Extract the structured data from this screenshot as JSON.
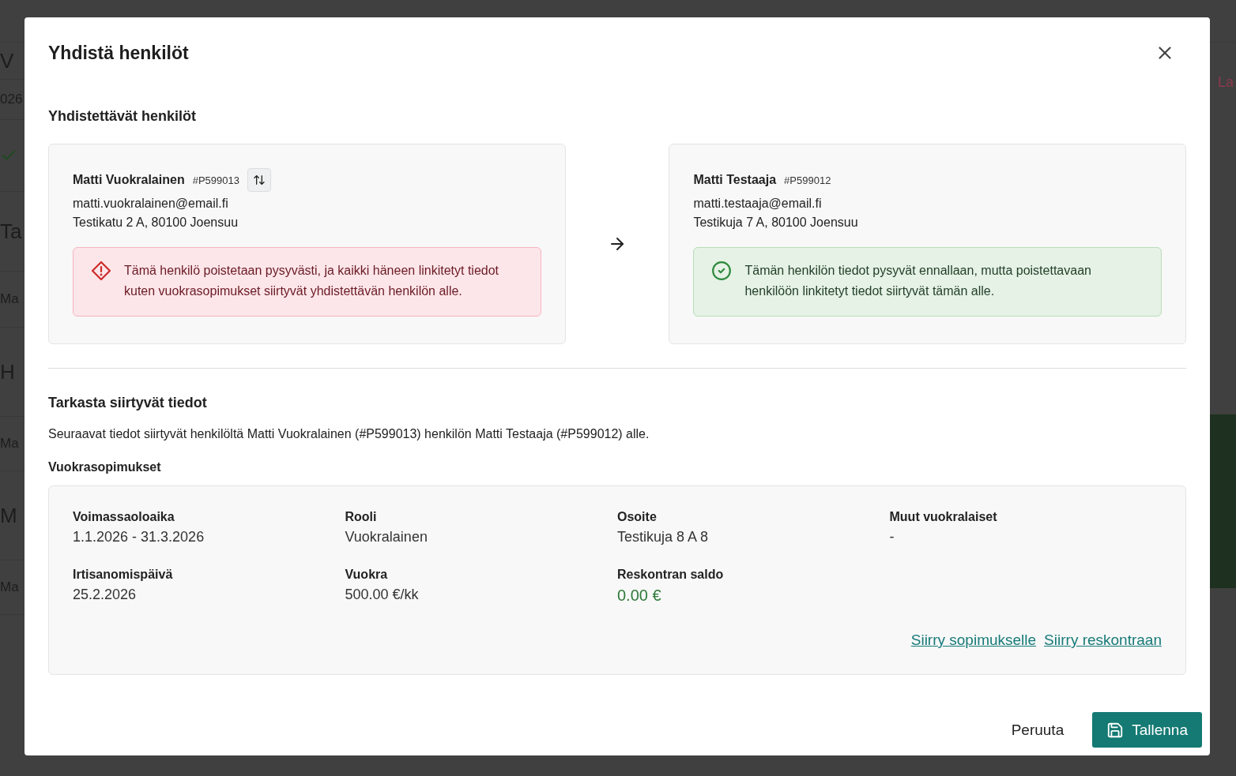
{
  "background": {
    "left_texts": [
      {
        "kind": "title",
        "text": "V"
      },
      {
        "kind": "small",
        "text": "026"
      },
      {
        "kind": "check"
      },
      {
        "kind": "heading",
        "text": "Ta"
      },
      {
        "kind": "small",
        "text": "Ma"
      },
      {
        "kind": "heading",
        "text": "H"
      },
      {
        "kind": "small",
        "text": "Ma"
      },
      {
        "kind": "heading",
        "text": "M"
      },
      {
        "kind": "small",
        "text": "Ma"
      }
    ],
    "right_text": "La"
  },
  "dialog": {
    "title": "Yhdistä henkilöt",
    "section_title": "Yhdistettävät henkilöt",
    "persons": [
      {
        "kind": "removed",
        "name": "Matti Vuokralainen",
        "id": "#P599013",
        "swap_button": true,
        "email": "matti.vuokralainen@email.fi",
        "address": "Testikatu 2 A, 80100 Joensuu",
        "notice": "Tämä henkilö poistetaan pysyvästi, ja kaikki häneen linkitetyt tiedot kuten vuokrasopimukset siirtyvät yhdistettävän henkilön alle."
      },
      {
        "kind": "kept",
        "name": "Matti Testaaja",
        "id": "#P599012",
        "swap_button": false,
        "email": "matti.testaaja@email.fi",
        "address": "Testikuja 7 A, 80100 Joensuu",
        "notice": "Tämän henkilön tiedot pysyvät ennallaan, mutta poistettavaan henkilöön linkitetyt tiedot siirtyvät tämän alle."
      }
    ],
    "transfer": {
      "title": "Tarkasta siirtyvät tiedot",
      "description": "Seuraavat tiedot siirtyvät henkilöltä Matti Vuokralainen (#P599013) henkilön Matti Testaaja (#P599012) alle.",
      "contracts_title": "Vuokrasopimukset",
      "fields": [
        {
          "kind": "text",
          "label": "Voimassaoloaika",
          "value": "1.1.2026 - 31.3.2026"
        },
        {
          "kind": "text",
          "label": "Rooli",
          "value": "Vuokralainen"
        },
        {
          "kind": "text",
          "label": "Osoite",
          "value": "Testikuja 8 A 8"
        },
        {
          "kind": "text",
          "label": "Muut vuokralaiset",
          "value": "-"
        },
        {
          "kind": "text",
          "label": "Irtisanomispäivä",
          "value": "25.2.2026"
        },
        {
          "kind": "text",
          "label": "Vuokra",
          "value": "500.00 €/kk"
        },
        {
          "kind": "balance",
          "label": "Reskontran saldo",
          "value": "0.00 €"
        }
      ],
      "links": [
        "Siirry sopimukselle",
        "Siirry reskontraan"
      ]
    },
    "cancel": "Peruuta",
    "save": "Tallenna"
  }
}
